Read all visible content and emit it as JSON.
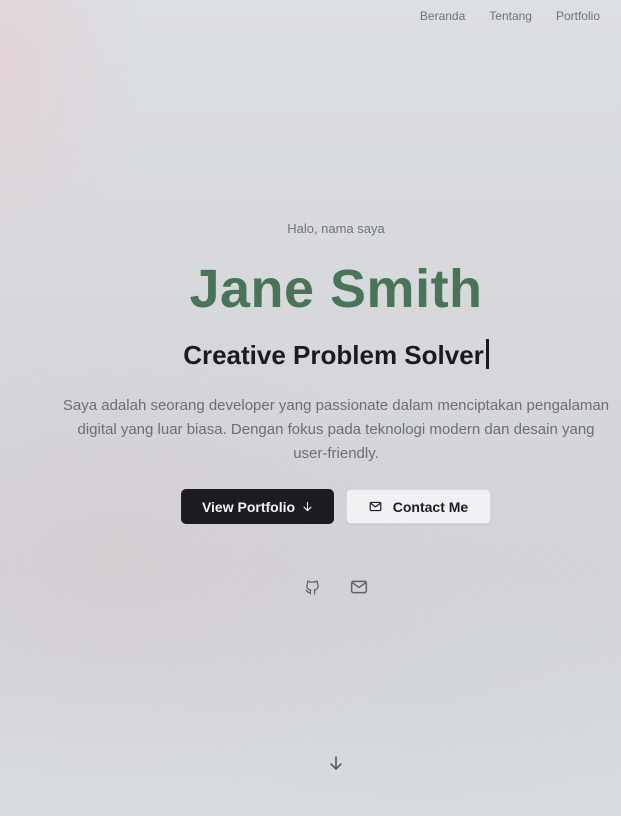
{
  "nav": {
    "items": [
      {
        "label": "Beranda"
      },
      {
        "label": "Tentang"
      },
      {
        "label": "Portfolio"
      }
    ]
  },
  "hero": {
    "greeting": "Halo, nama saya",
    "name": "Jane Smith",
    "tagline": "Creative Problem Solver",
    "description": "Saya adalah seorang developer yang passionate dalam menciptakan pengalaman digital yang luar biasa. Dengan fokus pada teknologi modern dan desain yang user-friendly.",
    "primary_button": {
      "label": "View Portfolio",
      "icon": "arrow-down-icon"
    },
    "secondary_button": {
      "label": "Contact Me",
      "icon": "mail-icon"
    }
  },
  "social": [
    {
      "icon": "github-icon"
    },
    {
      "icon": "mail-icon"
    }
  ],
  "scroll_indicator": {
    "icon": "arrow-down-icon"
  },
  "colors": {
    "name_accent": "#4a7458",
    "primary_button_bg": "#1c1b22",
    "text_dark": "#1b1a22",
    "text_muted": "#6a6e74"
  }
}
